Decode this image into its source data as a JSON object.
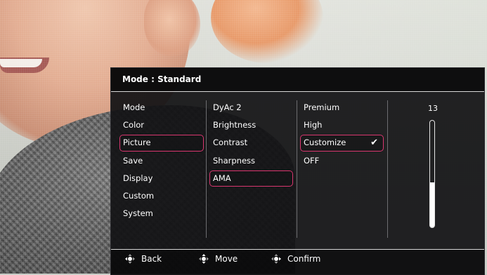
{
  "header": {
    "title": "Mode : Standard"
  },
  "menu": {
    "main_items": [
      {
        "label": "Mode"
      },
      {
        "label": "Color"
      },
      {
        "label": "Picture"
      },
      {
        "label": "Save"
      },
      {
        "label": "Display"
      },
      {
        "label": "Custom"
      },
      {
        "label": "System"
      }
    ],
    "selected_main": "Picture",
    "sub_items": [
      {
        "label": "DyAc 2"
      },
      {
        "label": "Brightness"
      },
      {
        "label": "Contrast"
      },
      {
        "label": "Sharpness"
      },
      {
        "label": "AMA"
      }
    ],
    "selected_sub": "AMA",
    "options": [
      {
        "label": "Premium"
      },
      {
        "label": "High"
      },
      {
        "label": "Customize"
      },
      {
        "label": "OFF"
      }
    ],
    "selected_option": "Customize",
    "check_icon": "check-icon"
  },
  "level": {
    "value": "13",
    "fraction": 0.42
  },
  "footer": {
    "back_label": "Back",
    "move_label": "Move",
    "confirm_label": "Confirm",
    "back_icon": "joystick-left-icon",
    "move_icon": "joystick-updown-icon",
    "confirm_icon": "joystick-press-icon"
  },
  "colors": {
    "highlight": "#d9366f",
    "panel": "#121214",
    "text": "#ffffff"
  }
}
